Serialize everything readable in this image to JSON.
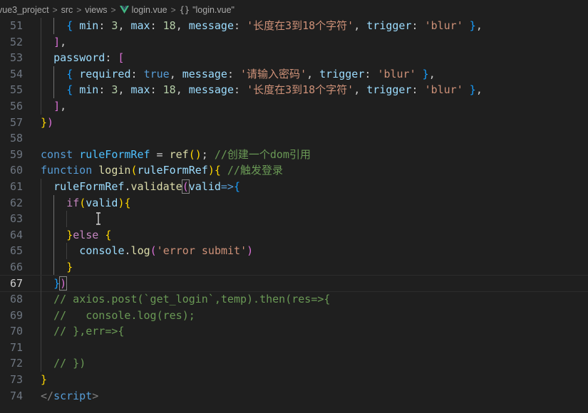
{
  "breadcrumb": {
    "items": [
      "vue3_project",
      "src",
      "views",
      "login.vue",
      "\"login.vue\""
    ],
    "object_icon": "{}",
    "separator": ">"
  },
  "editor": {
    "language": "vue",
    "active_line": 67,
    "lines": [
      {
        "n": "51",
        "indent": 2,
        "tokens": [
          [
            "b3",
            "{ "
          ],
          [
            "t-prop",
            "min"
          ],
          [
            "t-plain",
            ": "
          ],
          [
            "t-num",
            "3"
          ],
          [
            "t-plain",
            ", "
          ],
          [
            "t-prop",
            "max"
          ],
          [
            "t-plain",
            ": "
          ],
          [
            "t-num",
            "18"
          ],
          [
            "t-plain",
            ", "
          ],
          [
            "t-prop",
            "message"
          ],
          [
            "t-plain",
            ": "
          ],
          [
            "t-str",
            "'长度在3到18个字符'"
          ],
          [
            "t-plain",
            ", "
          ],
          [
            "t-prop",
            "trigger"
          ],
          [
            "t-plain",
            ": "
          ],
          [
            "t-str",
            "'blur'"
          ],
          [
            "t-plain",
            " "
          ],
          [
            "b3",
            "}"
          ],
          [
            "t-plain",
            ","
          ]
        ]
      },
      {
        "n": "52",
        "indent": 1,
        "tokens": [
          [
            "b2",
            "]"
          ],
          [
            "t-plain",
            ","
          ]
        ]
      },
      {
        "n": "53",
        "indent": 1,
        "tokens": [
          [
            "t-prop",
            "password"
          ],
          [
            "t-plain",
            ": "
          ],
          [
            "b2",
            "["
          ]
        ]
      },
      {
        "n": "54",
        "indent": 2,
        "tokens": [
          [
            "b3",
            "{ "
          ],
          [
            "t-prop",
            "required"
          ],
          [
            "t-plain",
            ": "
          ],
          [
            "t-kw",
            "true"
          ],
          [
            "t-plain",
            ", "
          ],
          [
            "t-prop",
            "message"
          ],
          [
            "t-plain",
            ": "
          ],
          [
            "t-str",
            "'请输入密码'"
          ],
          [
            "t-plain",
            ", "
          ],
          [
            "t-prop",
            "trigger"
          ],
          [
            "t-plain",
            ": "
          ],
          [
            "t-str",
            "'blur'"
          ],
          [
            "t-plain",
            " "
          ],
          [
            "b3",
            "}"
          ],
          [
            "t-plain",
            ","
          ]
        ]
      },
      {
        "n": "55",
        "indent": 2,
        "tokens": [
          [
            "b3",
            "{ "
          ],
          [
            "t-prop",
            "min"
          ],
          [
            "t-plain",
            ": "
          ],
          [
            "t-num",
            "3"
          ],
          [
            "t-plain",
            ", "
          ],
          [
            "t-prop",
            "max"
          ],
          [
            "t-plain",
            ": "
          ],
          [
            "t-num",
            "18"
          ],
          [
            "t-plain",
            ", "
          ],
          [
            "t-prop",
            "message"
          ],
          [
            "t-plain",
            ": "
          ],
          [
            "t-str",
            "'长度在3到18个字符'"
          ],
          [
            "t-plain",
            ", "
          ],
          [
            "t-prop",
            "trigger"
          ],
          [
            "t-plain",
            ": "
          ],
          [
            "t-str",
            "'blur'"
          ],
          [
            "t-plain",
            " "
          ],
          [
            "b3",
            "}"
          ],
          [
            "t-plain",
            ","
          ]
        ]
      },
      {
        "n": "56",
        "indent": 1,
        "tokens": [
          [
            "b2",
            "]"
          ],
          [
            "t-plain",
            ","
          ]
        ]
      },
      {
        "n": "57",
        "indent": 0,
        "tokens": [
          [
            "b1",
            "}"
          ],
          [
            "b2",
            ")"
          ]
        ]
      },
      {
        "n": "58",
        "indent": 0,
        "tokens": []
      },
      {
        "n": "59",
        "indent": 0,
        "tokens": [
          [
            "t-kw",
            "const "
          ],
          [
            "t-const",
            "ruleFormRef"
          ],
          [
            "t-plain",
            " = "
          ],
          [
            "t-fn",
            "ref"
          ],
          [
            "b1",
            "()"
          ],
          [
            "t-plain",
            "; "
          ],
          [
            "t-cmt",
            "//创建一个dom引用"
          ]
        ]
      },
      {
        "n": "60",
        "indent": 0,
        "tokens": [
          [
            "t-kw",
            "function "
          ],
          [
            "t-fn",
            "login"
          ],
          [
            "b1",
            "("
          ],
          [
            "t-var",
            "ruleFormRef"
          ],
          [
            "b1",
            ")"
          ],
          [
            "b1",
            "{"
          ],
          [
            "t-plain",
            " "
          ],
          [
            "t-cmt",
            "//触发登录"
          ]
        ]
      },
      {
        "n": "61",
        "indent": 1,
        "tokens": [
          [
            "t-var",
            "ruleFormRef"
          ],
          [
            "t-plain",
            "."
          ],
          [
            "t-fn",
            "validate"
          ],
          [
            "b2",
            "("
          ],
          [
            "t-var",
            "valid"
          ],
          [
            "t-kw",
            "=>"
          ],
          [
            "b3",
            "{"
          ]
        ]
      },
      {
        "n": "62",
        "indent": 2,
        "tokens": [
          [
            "t-ctl",
            "if"
          ],
          [
            "b1",
            "("
          ],
          [
            "t-var",
            "valid"
          ],
          [
            "b1",
            ")"
          ],
          [
            "b1",
            "{"
          ]
        ]
      },
      {
        "n": "63",
        "indent": 3,
        "tokens": []
      },
      {
        "n": "64",
        "indent": 2,
        "tokens": [
          [
            "b1",
            "}"
          ],
          [
            "t-ctl",
            "else"
          ],
          [
            "t-plain",
            " "
          ],
          [
            "b1",
            "{"
          ]
        ]
      },
      {
        "n": "65",
        "indent": 3,
        "tokens": [
          [
            "t-var",
            "console"
          ],
          [
            "t-plain",
            "."
          ],
          [
            "t-fn",
            "log"
          ],
          [
            "b2",
            "("
          ],
          [
            "t-str",
            "'error submit'"
          ],
          [
            "b2",
            ")"
          ]
        ]
      },
      {
        "n": "66",
        "indent": 2,
        "tokens": [
          [
            "b1",
            "}"
          ]
        ]
      },
      {
        "n": "67",
        "indent": 1,
        "tokens": [
          [
            "b3",
            "}"
          ],
          [
            "b2",
            ")"
          ]
        ]
      },
      {
        "n": "68",
        "indent": 1,
        "tokens": [
          [
            "t-cmt",
            "// axios.post(`get_login`,temp).then(res=>{"
          ]
        ]
      },
      {
        "n": "69",
        "indent": 1,
        "tokens": [
          [
            "t-cmt",
            "//   console.log(res);"
          ]
        ]
      },
      {
        "n": "70",
        "indent": 1,
        "tokens": [
          [
            "t-cmt",
            "// },err=>{"
          ]
        ]
      },
      {
        "n": "71",
        "indent": 1,
        "tokens": []
      },
      {
        "n": "72",
        "indent": 1,
        "tokens": [
          [
            "t-cmt",
            "// })"
          ]
        ]
      },
      {
        "n": "73",
        "indent": 0,
        "tokens": [
          [
            "b1",
            "}"
          ]
        ]
      },
      {
        "n": "74",
        "indent": 0,
        "tokens": [
          [
            "t-tag",
            "</"
          ],
          [
            "t-tagname",
            "script"
          ],
          [
            "t-tag",
            ">"
          ]
        ]
      }
    ]
  },
  "colors": {
    "background": "#1f1f1f",
    "vue_icon": "#41b883"
  },
  "icons": {
    "file_icon": "vue-icon",
    "symbol_icon": "object-icon",
    "pointer": "text-cursor-icon"
  }
}
